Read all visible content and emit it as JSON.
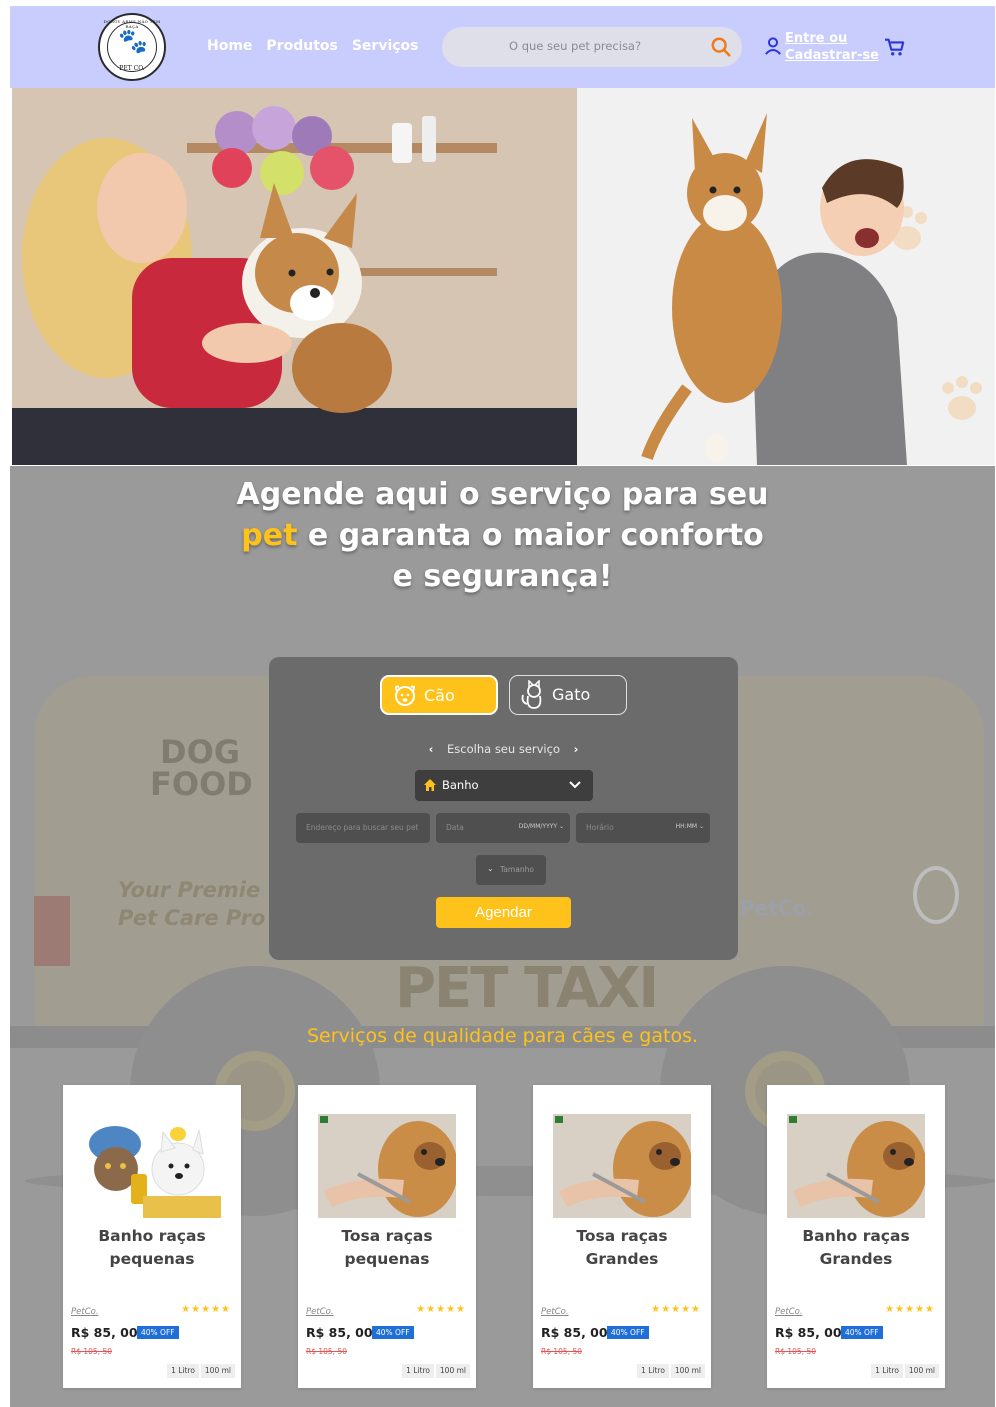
{
  "header": {
    "logo": {
      "arc_text": "DOGGY ARMS NÃO TEM RAÇA",
      "name": "PET CO."
    },
    "nav": [
      {
        "label": "Home"
      },
      {
        "label": "Produtos"
      },
      {
        "label": "Serviços"
      }
    ],
    "search": {
      "placeholder": "O que seu pet precisa?"
    },
    "login": {
      "line1": "Entre ou",
      "line2": "Cadastrar-se"
    },
    "icons": [
      "search-icon",
      "user-icon",
      "cart-icon"
    ]
  },
  "hero": {
    "left_alt": "groomer trimming corgi nails",
    "right_alt": "woman holding corgi"
  },
  "schedule": {
    "headline": {
      "part1": "Agende aqui o serviço para seu",
      "highlight": "pet",
      "part2": "e garanta o maior conforto",
      "part3": "e segurança!"
    },
    "tabs": [
      {
        "label": "Cão",
        "icon": "dog-icon",
        "active": true
      },
      {
        "label": "Gato",
        "icon": "cat-icon",
        "active": false
      }
    ],
    "service_nav": {
      "label": "Escolha seu serviço"
    },
    "service_select": {
      "value": "Banho"
    },
    "fields": {
      "address": {
        "placeholder": "Endereço para buscar seu pet"
      },
      "date": {
        "label": "Data",
        "format": "DD/MM/YYYY"
      },
      "time": {
        "label": "Horário",
        "format": "HH:MM"
      },
      "size": {
        "label": "Tamanho"
      }
    },
    "submit": {
      "label": "Agendar"
    },
    "background": {
      "dogfood_1": "DOG",
      "dogfood_2": "FOOD",
      "tagline_1": "Your Premie",
      "tagline_2": "Pet Care Pro",
      "taxi": "PET TAXI",
      "petco": "PetCo."
    }
  },
  "services": {
    "title": "Serviços de qualidade para cães e gatos.",
    "cards": [
      {
        "title1": "Banho raças",
        "title2": "pequenas",
        "brand": "PetCo.",
        "stars": "★★★★★",
        "price": "R$ 85, 00",
        "off": "40% OFF",
        "old_price": "R$ 105, 50",
        "chip1": "1 Litro",
        "chip2": "100 ml"
      },
      {
        "title1": "Tosa raças",
        "title2": "pequenas",
        "brand": "PetCo.",
        "stars": "★★★★★",
        "price": "R$ 85, 00",
        "off": "40% OFF",
        "old_price": "R$ 105, 50",
        "chip1": "1 Litro",
        "chip2": "100 ml"
      },
      {
        "title1": "Tosa raças",
        "title2": "Grandes",
        "brand": "PetCo.",
        "stars": "★★★★★",
        "price": "R$ 85, 00",
        "off": "40% OFF",
        "old_price": "R$ 105, 50",
        "chip1": "1 Litro",
        "chip2": "100 ml"
      },
      {
        "title1": "Banho raças",
        "title2": "Grandes",
        "brand": "PetCo.",
        "stars": "★★★★★",
        "price": "R$ 85, 00",
        "off": "40% OFF",
        "old_price": "R$ 105, 50",
        "chip1": "1 Litro",
        "chip2": "100 ml"
      }
    ]
  },
  "colors": {
    "header_bg": "#c8cdfd",
    "accent_yellow": "#ffc21a",
    "search_orange": "#f07a1a",
    "link_blue": "#2a36d8",
    "off_blue": "#1f6fd9"
  }
}
